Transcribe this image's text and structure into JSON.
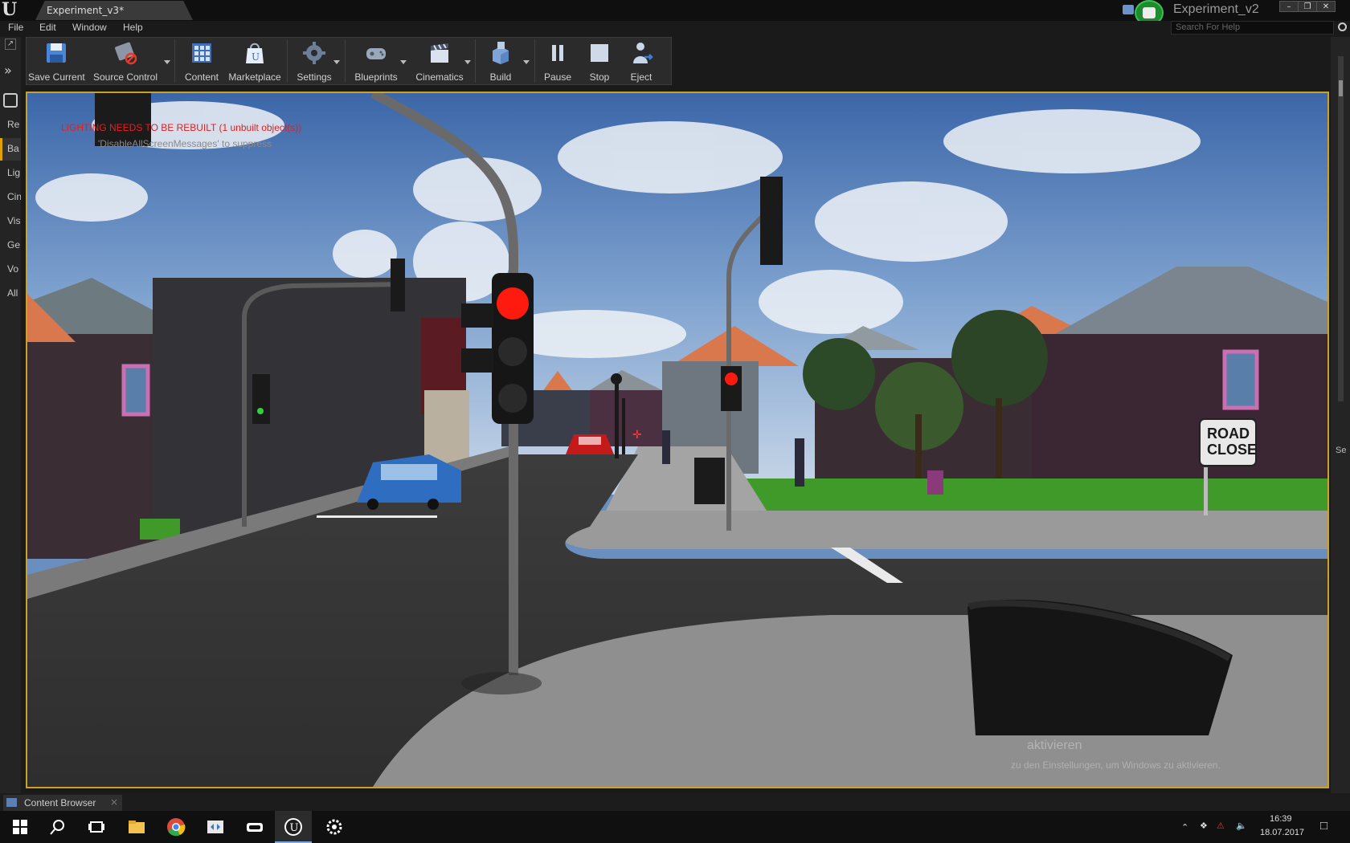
{
  "window": {
    "tab_title": "Experiment_v3*",
    "project_name": "Experiment_v2",
    "controls": {
      "minimize": "–",
      "restore": "❐",
      "close": "✕"
    }
  },
  "menu": {
    "file": "File",
    "edit": "Edit",
    "window": "Window",
    "help": "Help",
    "search_placeholder": "Search For Help"
  },
  "left_panel": {
    "items": [
      "Re",
      "Ba",
      "Lig",
      "Cin",
      "Vis",
      "Ge",
      "Vo",
      "All"
    ],
    "active_index": 1
  },
  "toolbar": {
    "save_current": "Save Current",
    "source_control": "Source Control",
    "content": "Content",
    "marketplace": "Marketplace",
    "settings": "Settings",
    "blueprints": "Blueprints",
    "cinematics": "Cinematics",
    "build": "Build",
    "pause": "Pause",
    "stop": "Stop",
    "eject": "Eject"
  },
  "viewport": {
    "warning": "LIGHTING NEEDS TO BE REBUILT (1 unbuilt object(s))",
    "hint": "'DisableAllScreenMessages' to suppress",
    "road_sign": "ROAD CLOSED",
    "watermark_title": "aktivieren",
    "watermark_sub": "zu den Einstellungen, um Windows zu aktivieren."
  },
  "right_panel": {
    "label": "Se"
  },
  "bottom": {
    "content_browser": "Content Browser"
  },
  "taskbar": {
    "time": "16:39",
    "date": "18.07.2017"
  },
  "colors": {
    "accent_border": "#c9a227",
    "warning_text": "#e81d1d",
    "traffic_red": "#ff1a0f"
  }
}
